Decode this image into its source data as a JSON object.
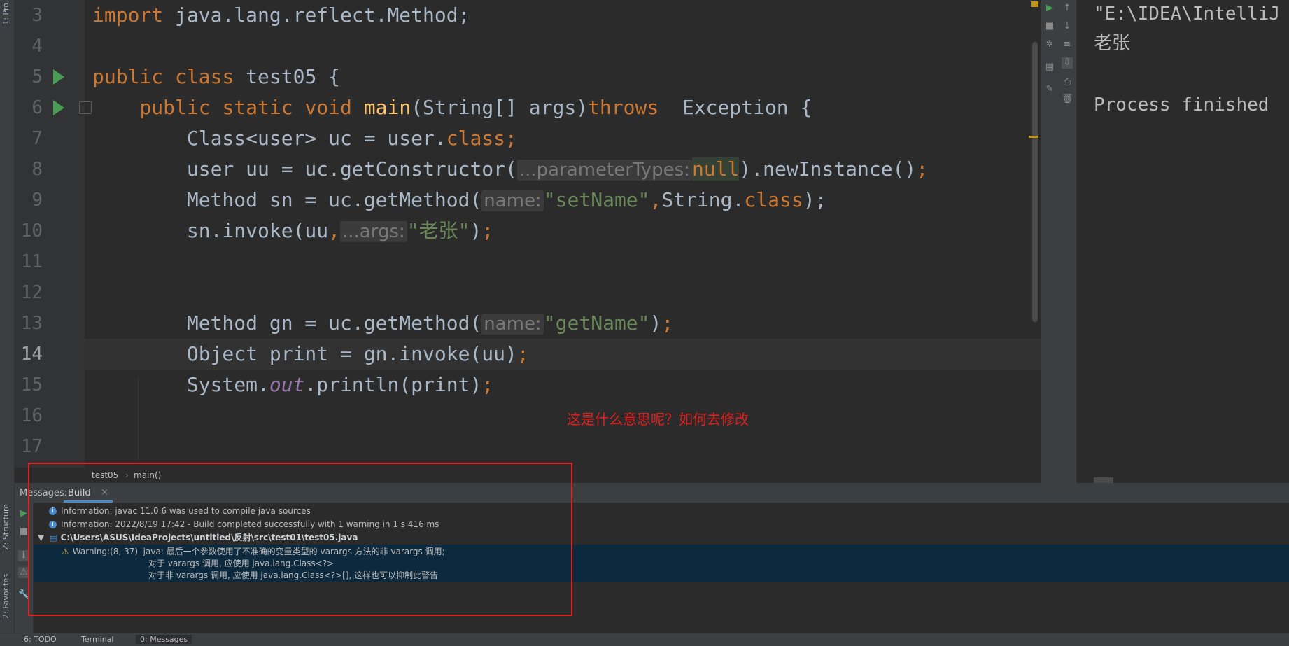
{
  "left_strip": {
    "project_tab": "1: Pro",
    "structure_tab": "Z: Structure",
    "favorites_tab": "2: Favorites"
  },
  "gutter": {
    "line_numbers": [
      "3",
      "4",
      "5",
      "6",
      "7",
      "8",
      "9",
      "10",
      "11",
      "12",
      "13",
      "14",
      "15",
      "16",
      "17"
    ],
    "current_line": "14"
  },
  "code": {
    "l3_import": "import",
    "l3_rest": " java.lang.reflect.Method;",
    "l5_public": "public",
    "l5_class": "class",
    "l5_name": " test05 {",
    "l6_indent": "    ",
    "l6_public": "public",
    "l6_static": "static",
    "l6_void": "void",
    "l6_main": "main",
    "l6_args": "(String[] args)",
    "l6_throws": "throws",
    "l6_exc": "  Exception {",
    "l7_a": "        Class<user> uc = user.",
    "l7_class": "class",
    "l7_semi": ";",
    "l8_a": "        user uu = uc.getConstructor(",
    "l8_hint": "...parameterTypes:",
    "l8_null": "null",
    "l8_b": ").newInstance()",
    "l8_semi": ";",
    "l9_a": "        Method sn = uc.getMethod(",
    "l9_hint": "name:",
    "l9_str": "\"setName\"",
    "l9_comma": ",",
    "l9_b": "String.",
    "l9_class": "class",
    "l9_c": ");",
    "l10_a": "        sn.invoke(uu",
    "l10_comma": ",",
    "l10_hint": "...args:",
    "l10_str": "\"老张\"",
    "l10_b": ")",
    "l10_semi": ";",
    "l13_a": "        Method gn = uc.getMethod(",
    "l13_hint": "name:",
    "l13_str": "\"getName\"",
    "l13_b": ")",
    "l13_semi": ";",
    "l14_a": "        Object print = gn.invoke(uu)",
    "l14_semi": ";",
    "l15_a": "        System.",
    "l15_out": "out",
    "l15_b": ".println(print)",
    "l15_semi": ";"
  },
  "annotation": "这是什么意思呢？如何去修改",
  "breadcrumb": {
    "class": "test05",
    "sep": "›",
    "method": "main()"
  },
  "console": {
    "line1": "\"E:\\IDEA\\IntelliJ",
    "line2": "老张",
    "line3": "Process finished "
  },
  "messages": {
    "label": "Messages:",
    "tab": "Build",
    "close": "×",
    "info1": "Information: javac 11.0.6 was used to compile java sources",
    "info2": "Information: 2022/8/19 17:42 - Build completed successfully with 1 warning in 1 s 416 ms",
    "file_path": "C:\\Users\\ASUS\\IdeaProjects\\untitled\\反射\\src\\test01\\test05.java",
    "warning_line1": "Warning:(8, 37)  java: 最后一个参数使用了不准确的变量类型的 varargs 方法的非 varargs 调用;",
    "warning_line2": "对于 varargs 调用, 应使用 java.lang.Class<?>",
    "warning_line3": "对于非 varargs 调用, 应使用 java.lang.Class<?>[], 这样也可以抑制此警告"
  },
  "status_bar": {
    "todo": "6: TODO",
    "terminal": "Terminal",
    "messages": "0: Messages"
  }
}
